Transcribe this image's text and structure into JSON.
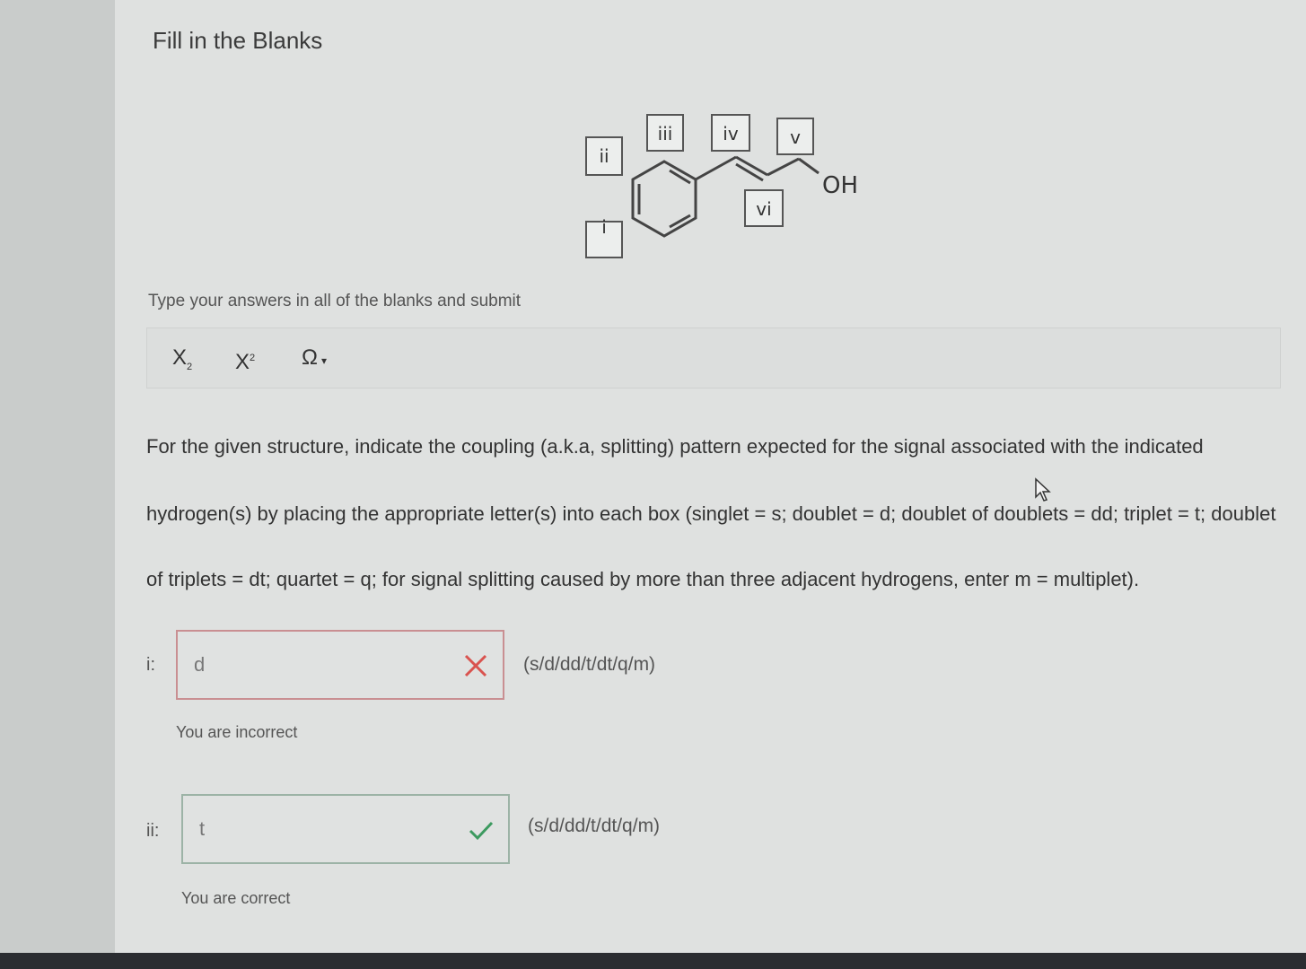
{
  "heading": "Fill in the Blanks",
  "structure": {
    "labels": [
      "i",
      "ii",
      "iii",
      "iv",
      "v",
      "vi"
    ],
    "group": "OH"
  },
  "instruction": "Type your answers in all of the blanks and submit",
  "toolbar": {
    "subscript": "X",
    "subscript_mark": "2",
    "superscript": "X",
    "superscript_mark": "2",
    "special_chars": "Ω",
    "special_chars_caret": "▾"
  },
  "question": {
    "line1": "For the given structure, indicate the coupling (a.k.a, splitting) pattern expected for the signal associated with the indicated",
    "line2": "hydrogen(s) by placing the appropriate letter(s) into each box (singlet = s; doublet = d; doublet of doublets = dd; triplet = t; doublet",
    "line3": "of triplets = dt; quartet = q; for signal splitting caused by more than three adjacent hydrogens, enter m = multiplet)."
  },
  "answers": [
    {
      "label": "i:",
      "value": "d",
      "hint": "(s/d/dd/t/dt/q/m)",
      "feedback": "You are incorrect",
      "status": "incorrect"
    },
    {
      "label": "ii:",
      "value": "t",
      "hint": "(s/d/dd/t/dt/q/m)",
      "feedback": "You are correct",
      "status": "correct"
    }
  ],
  "colors": {
    "incorrect": "#d9534f",
    "correct": "#3c9a5f"
  }
}
